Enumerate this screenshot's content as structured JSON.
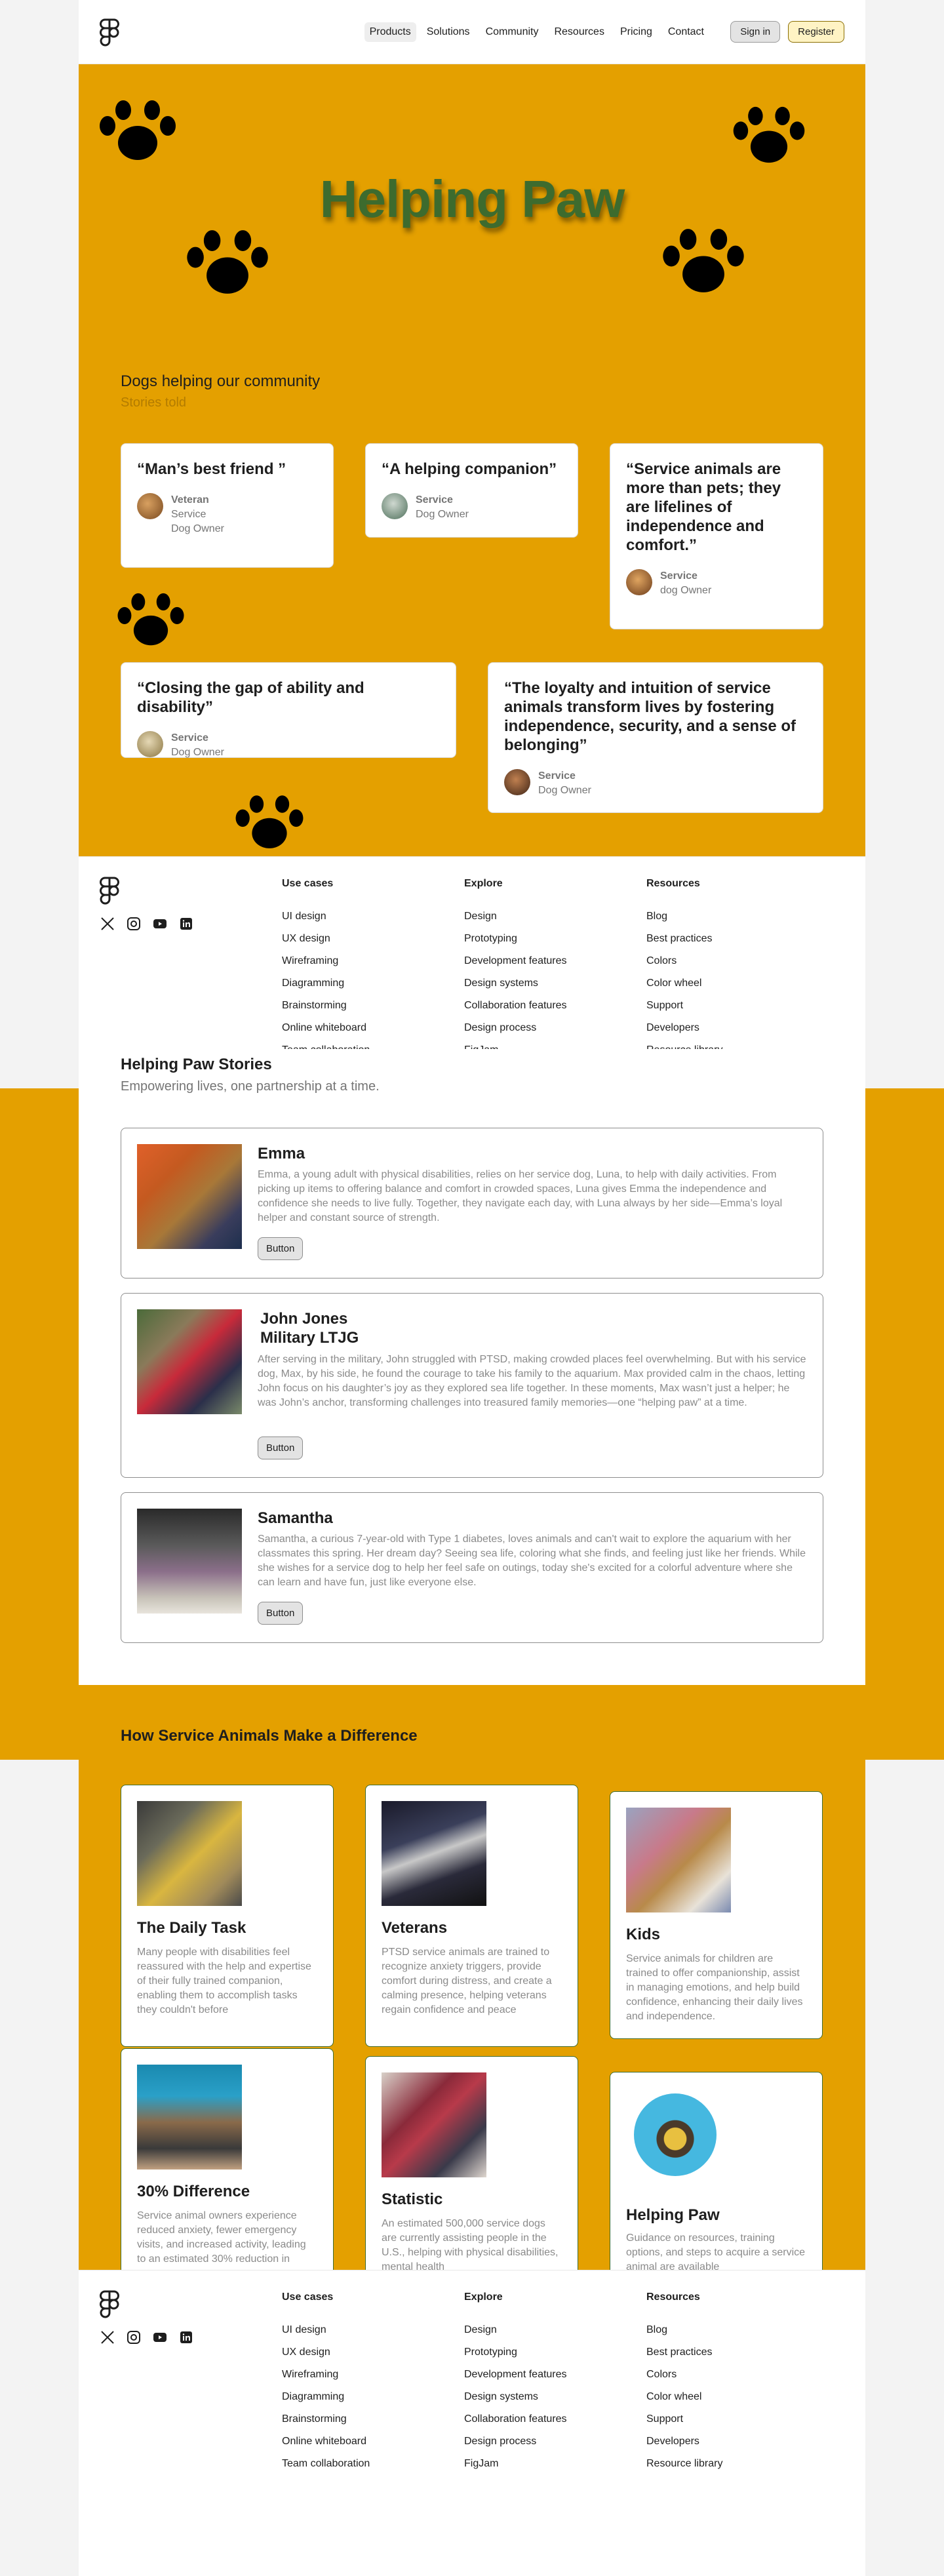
{
  "header": {
    "nav": [
      "Products",
      "Solutions",
      "Community",
      "Resources",
      "Pricing",
      "Contact"
    ],
    "sign_in": "Sign in",
    "register": "Register"
  },
  "hero": {
    "title": "Helping Paw",
    "section_heading": "Dogs helping our community",
    "section_sub": "Stories told"
  },
  "quotes": [
    {
      "text": "“Man’s best friend ”",
      "name": "Veteran",
      "role": "Service\nDog Owner"
    },
    {
      "text": "“A helping companion”",
      "name": "Service",
      "role": "Dog Owner"
    },
    {
      "text": "“Service animals are more than pets; they are lifelines of independence and comfort.”",
      "name": "Service",
      "role": "dog Owner"
    },
    {
      "text": "“Closing the gap  of ability and disability”",
      "name": "Service",
      "role": "Dog Owner"
    },
    {
      "text": "“The loyalty and intuition of service animals transform lives by fostering independence, security, and a sense of belonging”",
      "name": "Service",
      "role": "Dog Owner"
    }
  ],
  "footer": {
    "columns": [
      {
        "title": "Use cases",
        "items": [
          "UI design",
          "UX design",
          "Wireframing",
          "Diagramming",
          "Brainstorming",
          "Online whiteboard",
          "Team collaboration"
        ]
      },
      {
        "title": "Explore",
        "items": [
          "Design",
          "Prototyping",
          "Development features",
          "Design systems",
          "Collaboration features",
          "Design process",
          "FigJam"
        ]
      },
      {
        "title": "Resources",
        "items": [
          "Blog",
          "Best practices",
          "Colors",
          "Color wheel",
          "Support",
          "Developers",
          "Resource library"
        ]
      }
    ]
  },
  "stories": {
    "title": "Helping Paw Stories",
    "subtitle": "Empowering lives, one partnership at a time.",
    "items": [
      {
        "name": "Emma",
        "text": "Emma, a young adult with physical disabilities, relies on her service dog, Luna, to help with daily activities. From picking up items to offering balance and comfort in crowded spaces, Luna gives Emma the independence and confidence she needs to live fully. Together, they navigate each day, with Luna always by her side—Emma’s loyal helper and constant source of strength.",
        "button": "Button"
      },
      {
        "name": "John Jones\nMilitary LTJG",
        "text": "After serving in the military, John struggled with PTSD, making crowded places feel overwhelming. But with his service dog, Max, by his side, he found the courage to take his family to the aquarium. Max provided calm in the chaos, letting John focus on his daughter’s joy as they explored sea life together. In these moments, Max wasn’t just a helper; he was John’s anchor, transforming challenges into treasured family memories—one “helping paw” at a time.",
        "button": "Button"
      },
      {
        "name": "Samantha",
        "text": "Samantha, a curious 7-year-old with Type 1 diabetes, loves animals and can't wait to explore the aquarium with her classmates this spring. Her dream day? Seeing sea life, coloring what she finds, and feeling just like her friends. While she wishes for a service dog to help her feel safe on outings, today she's excited for a colorful adventure where she can learn and have fun, just like everyone else.",
        "button": "Button"
      }
    ]
  },
  "impact": {
    "title": "How Service Animals Make a Difference",
    "cards": [
      {
        "name": "The Daily Task",
        "text": "Many people with disabilities feel reassured with the help and expertise of their fully trained companion, enabling them to accomplish tasks they couldn't before"
      },
      {
        "name": "Veterans",
        "text": "PTSD service animals are trained to recognize anxiety triggers, provide comfort during distress, and create a calming presence, helping veterans regain confidence and peace"
      },
      {
        "name": "Kids",
        "text": "Service animals for children are trained to offer companionship, assist in managing emotions, and help build confidence, enhancing their daily lives and independence."
      },
      {
        "name": "30% Difference",
        "text": "Service animal owners experience reduced anxiety, fewer emergency visits, and increased activity, leading to an estimated 30% reduction in"
      },
      {
        "name": "Statistic",
        "text": "An estimated 500,000 service dogs are currently assisting people in the U.S., helping with physical disabilities, mental health"
      },
      {
        "name": "Helping Paw",
        "text": "Guidance on resources, training options, and steps to acquire a service animal are available"
      }
    ]
  },
  "colors": {
    "brand": "#e4a000",
    "title_green": "#3d6b2e"
  },
  "icons": [
    "figma-logo-icon",
    "x-icon",
    "instagram-icon",
    "youtube-icon",
    "linkedin-icon",
    "paw-icon"
  ]
}
